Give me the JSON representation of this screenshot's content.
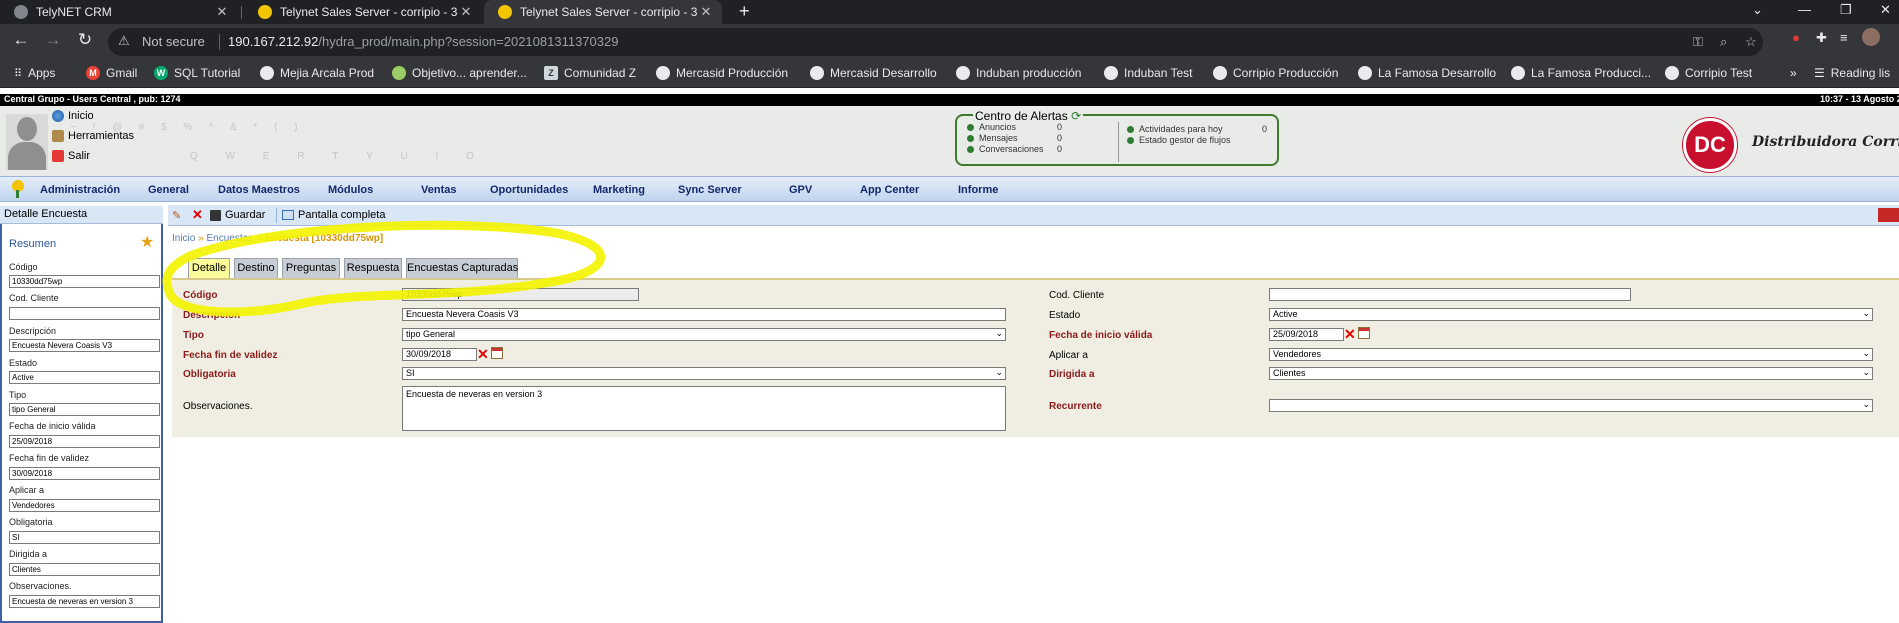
{
  "browser": {
    "tabs": [
      {
        "title": "TelyNET CRM",
        "active": false
      },
      {
        "title": "Telynet Sales Server - corripio - 3",
        "active": false
      },
      {
        "title": "Telynet Sales Server - corripio - 3",
        "active": true
      }
    ],
    "not_secure": "Not secure",
    "url_host": "190.167.212.92",
    "url_path": "/hydra_prod/main.php?session=2021081311370329",
    "bookmarks": [
      "Apps",
      "Gmail",
      "SQL Tutorial",
      "Mejia Arcala Prod",
      "Objetivo... aprender...",
      "Comunidad Z",
      "Mercasid Producción",
      "Mercasid Desarrollo",
      "Induban producción",
      "Induban Test",
      "Corripio Producción",
      "La Famosa Desarrollo",
      "La Famosa Producci...",
      "Corripio Test"
    ],
    "reading_list": "Reading lis"
  },
  "app": {
    "status_left": "Central Grupo - Users Central , pub: 1274",
    "status_right": "10:37 - 13 Agosto 20",
    "header_links": [
      "Inicio",
      "Herramientas",
      "Salir"
    ],
    "alerts": {
      "title": "Centro de Alertas",
      "left": [
        {
          "label": "Anuncios",
          "count": "0"
        },
        {
          "label": "Mensajes",
          "count": "0"
        },
        {
          "label": "Conversaciones",
          "count": "0"
        }
      ],
      "right": [
        {
          "label": "Actividades para hoy",
          "count": "0"
        },
        {
          "label": "Estado gestor de flujos",
          "count": ""
        }
      ]
    },
    "logo_mark": "DC",
    "logo_text": "Distribuidora Corripio",
    "menu": [
      "Administración",
      "General",
      "Datos Maestros",
      "Módulos",
      "Ventas",
      "Oportunidades",
      "Marketing",
      "Sync Server",
      "GPV",
      "App Center",
      "Informe"
    ]
  },
  "left_panel": {
    "title": "Detalle Encuesta",
    "section": "Resumen",
    "fields": [
      {
        "label": "Código",
        "value": "10330dd75wp"
      },
      {
        "label": "Cod. Cliente",
        "value": ""
      },
      {
        "label": "Descripción",
        "value": "Encuesta Nevera Coasis V3"
      },
      {
        "label": "Estado",
        "value": "Active"
      },
      {
        "label": "Tipo",
        "value": "tipo General"
      },
      {
        "label": "Fecha de inicio válida",
        "value": "25/09/2018"
      },
      {
        "label": "Fecha fin de validez",
        "value": "30/09/2018"
      },
      {
        "label": "Aplicar a",
        "value": "Vendedores"
      },
      {
        "label": "Obligatoria",
        "value": "SI"
      },
      {
        "label": "Dirigida a",
        "value": "Clientes"
      },
      {
        "label": "Observaciones.",
        "value": "Encuesta de neveras en version 3"
      }
    ]
  },
  "toolbar": {
    "save": "Guardar",
    "fullscreen": "Pantalla completa"
  },
  "breadcrumb": {
    "home": "Inicio",
    "sep": "»",
    "list": "Encuestas",
    "current": "Encuesta [10330dd75wp]"
  },
  "tabs": [
    "Detalle",
    "Destino",
    "Preguntas",
    "Respuesta",
    "Encuestas Capturadas"
  ],
  "form": {
    "codigo": {
      "label": "Código",
      "value": "10330dd75wp"
    },
    "descripcion": {
      "label": "Descripción",
      "value": "Encuesta Nevera Coasis V3"
    },
    "tipo": {
      "label": "Tipo",
      "value": "tipo General"
    },
    "fecha_fin": {
      "label": "Fecha fin de validez",
      "value": "30/09/2018"
    },
    "obligatoria": {
      "label": "Obligatoria",
      "value": "SI"
    },
    "observaciones": {
      "label": "Observaciones.",
      "value": "Encuesta de neveras en version 3"
    },
    "cod_cliente": {
      "label": "Cod. Cliente",
      "value": ""
    },
    "estado": {
      "label": "Estado",
      "value": "Active"
    },
    "fecha_inicio": {
      "label": "Fecha de inicio válida",
      "value": "25/09/2018"
    },
    "aplicar": {
      "label": "Aplicar a",
      "value": "Vendedores"
    },
    "dirigida": {
      "label": "Dirigida a",
      "value": "Clientes"
    },
    "recurrente": {
      "label": "Recurrente",
      "value": ""
    }
  },
  "colors": {
    "chrome_dark": "#202124",
    "chrome_mid": "#35363a",
    "menu_text": "#14276b",
    "required_label": "#8b1a1a",
    "highlight": "#f3f300",
    "form_bg": "#f0eee2",
    "active_tab": "#fbfb9a"
  }
}
